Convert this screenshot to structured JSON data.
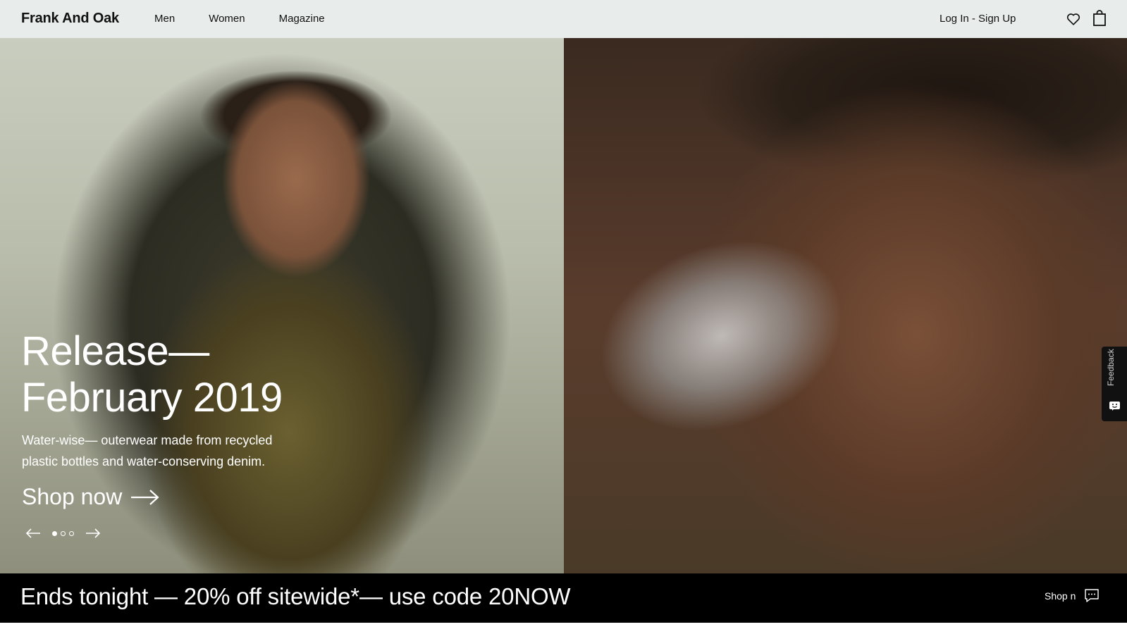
{
  "header": {
    "logo": "Frank And Oak",
    "nav": [
      {
        "label": "Men"
      },
      {
        "label": "Women"
      },
      {
        "label": "Magazine"
      }
    ],
    "account_link": "Log In - Sign Up",
    "icons": {
      "wishlist": "heart-icon",
      "cart": "shopping-bag-icon"
    }
  },
  "hero": {
    "headline_line1": "Release—",
    "headline_line2": "February 2019",
    "subtext": "Water-wise— outerwear made from recycled plastic bottles and water-conserving denim.",
    "cta": "Shop now",
    "slider": {
      "total": 3,
      "active": 1
    }
  },
  "feedback": {
    "label": "Feedback"
  },
  "promo": {
    "text": "Ends tonight — 20% off sitewide*— use code 20NOW",
    "link": "Shop n"
  },
  "colors": {
    "header_bg": "#e8ecea",
    "promo_bg": "#000000",
    "text_light": "#ffffff"
  }
}
